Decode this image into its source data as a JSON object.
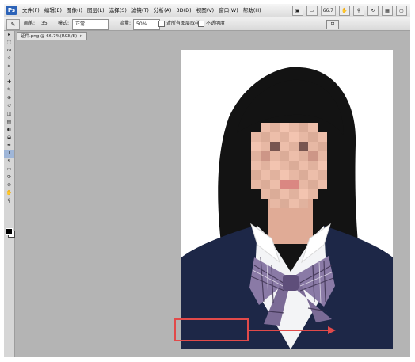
{
  "app": {
    "logo": "Ps"
  },
  "menu": {
    "items": [
      "文件(F)",
      "编辑(E)",
      "图像(I)",
      "图层(L)",
      "选择(S)",
      "滤镜(T)",
      "分析(A)",
      "3D(D)",
      "视图(V)",
      "窗口(W)",
      "帮助(H)"
    ],
    "zoom_value": "66.7"
  },
  "options": {
    "brush_label": "画笔:",
    "brush_size": "35",
    "mode_label": "模式:",
    "mode_value": "正常",
    "opacity_label": "流量:",
    "opacity_value": "50%",
    "sample_all_label": "对所有图层取样",
    "aligned_label": "不透明度"
  },
  "document": {
    "tab_label": "证件.png @ 66.7%(RGB/8)",
    "close_glyph": "×"
  },
  "toolbox": {
    "tools": [
      "move-icon",
      "marquee-icon",
      "lasso-icon",
      "magic-wand-icon",
      "crop-icon",
      "eyedropper-icon",
      "healing-icon",
      "brush-icon",
      "stamp-icon",
      "history-brush-icon",
      "eraser-icon",
      "gradient-icon",
      "blur-icon",
      "dodge-icon",
      "pen-icon",
      "type-icon",
      "path-select-icon",
      "shape-icon",
      "3d-rotate-icon",
      "3d-orbit-icon",
      "hand-icon",
      "zoom-icon"
    ],
    "tool_glyphs": [
      "▸",
      "⬚",
      "ᔕ",
      "✧",
      "⌗",
      "⁄",
      "✚",
      "✎",
      "⊕",
      "↺",
      "◫",
      "▤",
      "◐",
      "◒",
      "✒",
      "T",
      "↖",
      "▭",
      "⟳",
      "⊚",
      "✋",
      "⚲"
    ],
    "active_index": 15
  },
  "colors": {
    "annotation": "#e24a4a",
    "suit": "#1d2747",
    "shirt": "#f3f4f6",
    "hair": "#131313",
    "skin": "#e7b8a4"
  }
}
